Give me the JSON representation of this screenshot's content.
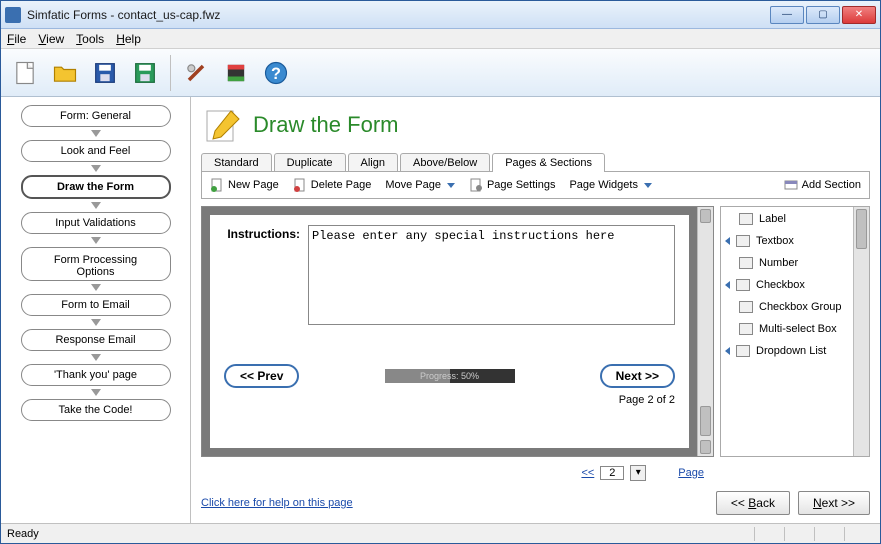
{
  "app": {
    "title": "Simfatic Forms - contact_us-cap.fwz"
  },
  "menu": {
    "file": "File",
    "view": "View",
    "tools": "Tools",
    "help": "Help"
  },
  "sidebar": {
    "steps": [
      "Form: General",
      "Look and Feel",
      "Draw the Form",
      "Input Validations",
      "Form Processing Options",
      "Form to Email",
      "Response Email",
      "'Thank you' page",
      "Take the Code!"
    ],
    "active_index": 2
  },
  "header": {
    "title": "Draw the Form"
  },
  "tabs": {
    "items": [
      "Standard",
      "Duplicate",
      "Align",
      "Above/Below",
      "Pages & Sections"
    ],
    "active_index": 4
  },
  "subtoolbar": {
    "new_page": "New Page",
    "delete_page": "Delete Page",
    "move_page": "Move Page",
    "page_settings": "Page Settings",
    "page_widgets": "Page Widgets",
    "add_section": "Add Section"
  },
  "form": {
    "instructions_label": "Instructions:",
    "instructions_value": "Please enter any special instructions here",
    "prev": "<< Prev",
    "next": "Next >>",
    "progress_text": "Progress: 50%",
    "page_label": "Page 2 of 2"
  },
  "palette": {
    "items": [
      "Label",
      "Textbox",
      "Number",
      "Checkbox",
      "Checkbox Group",
      "Multi-select Box",
      "Dropdown List"
    ]
  },
  "pager": {
    "back": "<<",
    "value": "2",
    "link": "Page"
  },
  "footer": {
    "help": "Click here for help on this page",
    "back": "<< Back",
    "next": "Next >>"
  },
  "status": {
    "text": "Ready"
  }
}
